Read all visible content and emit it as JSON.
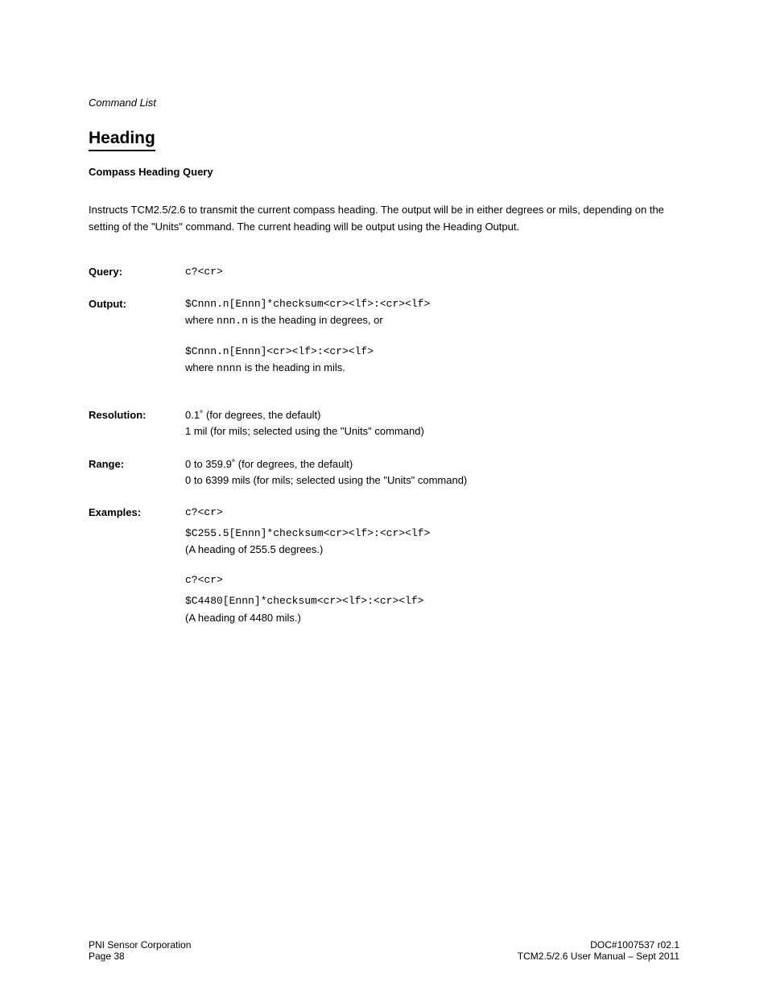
{
  "header": {
    "breadcrumb": "Command List"
  },
  "title": "Heading",
  "subtitle": "Compass Heading Query",
  "intro": "Instructs TCM2.5/2.6 to transmit the current compass heading. The output will be in either degrees or mils, depending on the setting of the \"Units\" command. The current heading will be output using the Heading Output.",
  "rows": {
    "query": {
      "label": "Query:",
      "value": "c?<cr>"
    },
    "output": {
      "label": "Output:",
      "line1": "$Cnnn.n[Ennn]*checksum<cr><lf>:<cr><lf>",
      "desc_prefix": "where ",
      "desc_mono": "nnn.n",
      "desc_suffix": " is the heading in degrees, or",
      "line2": "$Cnnn.n[Ennn]<cr><lf>:<cr><lf>",
      "desc2_prefix": "where ",
      "desc2_mono": "nnnn",
      "desc2_suffix": " is the heading in mils."
    },
    "resolution": {
      "label": "Resolution:",
      "degrees_value": "0.1",
      "degrees_note": "(for degrees, the default)",
      "mils_value": "1 mil (for mils; selected using the \"Units\" command)"
    },
    "range": {
      "label": "Range:",
      "degrees_value": "0 to 359.9",
      "degrees_note": "(for degrees, the default)",
      "mils_value": "0 to 6399 mils (for mils; selected using the \"Units\" command)"
    },
    "examples": {
      "label": "Examples:",
      "ex1_cmd": "c?<cr>",
      "ex1_resp": "$C255.5[Ennn]*checksum<cr><lf>:<cr><lf>",
      "ex1_desc": "(A heading of 255.5 degrees.)",
      "ex2_cmd": "c?<cr>",
      "ex2_resp": "$C4480[Ennn]*checksum<cr><lf>:<cr><lf>",
      "ex2_desc": "(A heading of 4480 mils.)"
    }
  },
  "footer": {
    "product": "PNI Sensor Corporation",
    "doc": "DOC#1007537 r02.1",
    "page": "Page 38",
    "manual": "TCM2.5/2.6 User Manual – Sept 2011"
  }
}
